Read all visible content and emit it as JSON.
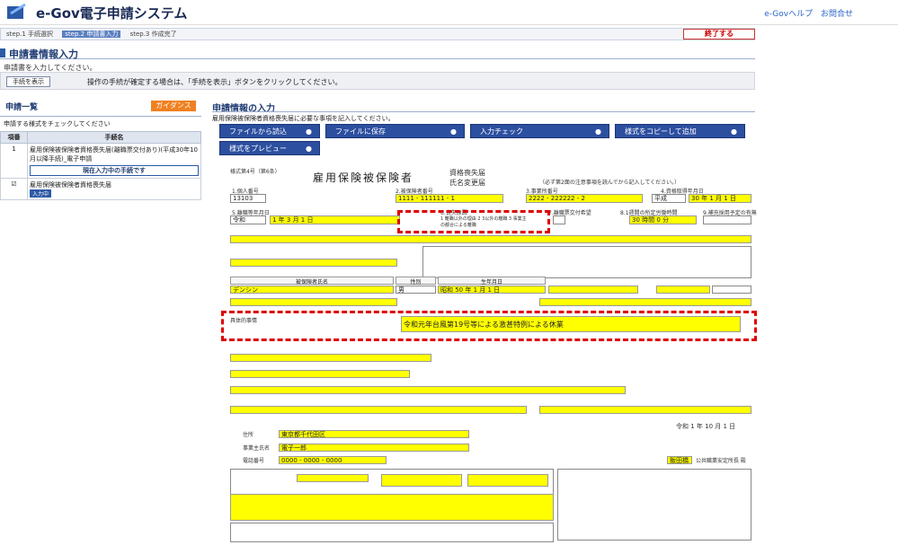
{
  "app": {
    "title": "e-Gov電子申請システム",
    "help_link": "e-Govヘルプ",
    "contact_link": "お問合せ"
  },
  "steps": [
    {
      "label": "step.1 手続選択"
    },
    {
      "label": "step.2 申請書入力"
    },
    {
      "label": "step.3 作成完了"
    }
  ],
  "end_button": "終了する",
  "section_title": "申請書情報入力",
  "section_sub": "申請書を入力してください。",
  "procedure_button": "手続を表示",
  "procedure_note": "操作の手続が確定する場合は、「手続を表示」ボタンをクリックしてください。",
  "side": {
    "title": "申請一覧",
    "guide_button": "ガイダンス",
    "hint": "申請する様式をチェックしてください",
    "col_no": "項番",
    "col_name": "手続名",
    "rows": [
      {
        "no": "1",
        "name": "雇用保険被保険者資格喪失届(離職票交付あり)(平成30年10月以降手続)_電子申請",
        "button": "現在入力中の手続です"
      },
      {
        "no": "",
        "name": "雇用保険被保険者資格喪失届",
        "badge": "入力中"
      }
    ]
  },
  "main": {
    "title": "申請情報の入力",
    "sub": "雇用保険被保険者資格喪失届に必要な事項を記入してください。",
    "tools": {
      "load": "ファイルから読込",
      "save": "ファイルに保存",
      "check": "入力チェック",
      "copy": "様式をコピーして追加",
      "preview": "様式をプレビュー"
    }
  },
  "form": {
    "form_no": "様式第4号（第6条）",
    "title": "雇用保険被保険者",
    "opt1": "資格喪失届",
    "opt2": "氏名変更届",
    "note": "（必ず第2面の注意事項を読んでから記入してください。）",
    "f1_label": "1.個人番号",
    "f1_value": "13103",
    "f2_label": "2.被保険者番号",
    "f2_value": "1111 - 111111 - 1",
    "f3_label": "3.事業所番号",
    "f3_value": "2222 - 222222 - 2",
    "f4_label": "4.資格取得年月日",
    "f4_era": "平成",
    "f4_value": "30 年 1 月 1 日",
    "f5_label": "5.離職等年月日",
    "f5_era": "令和",
    "f5_value": "1 年 3 月 1 日",
    "f6_label": "6.喪失原因",
    "f6_opts": "1 離職以外の理由 2 3以外の離職 3 事業主の都合による離職",
    "f7_label": "7.離職票交付希望",
    "f8_label": "8.1週間の所定労働時間",
    "f8_value": "30 時間 0 分",
    "f9_label": "9.補充採用予定の有無",
    "name_label": "被保険者氏名",
    "name_value": "デンシン",
    "kana_label": "フリガナ",
    "sex_label": "性別",
    "sex_value": "男",
    "birth_label": "生年月日",
    "birth_value": "昭和 50 年 1 月 1 日",
    "reason_label": "具体的事情",
    "reason_value": "令和元年台風第19号等による激甚特例による休業",
    "addr_label": "住所",
    "addr_value": "東京都千代田区",
    "owner_label": "事業主氏名",
    "owner_value": "電子一郎",
    "tel_label": "電話番号",
    "tel_value": "0000 - 0000 - 0000",
    "date_label": "令和 1 年 10 月 1 日",
    "office": "飯田橋",
    "office_suffix": "公共職業安定所長 殿"
  },
  "colors": {
    "accent": "#2c5aa6",
    "highlight": "#ffff00",
    "alert": "#dd0000"
  }
}
